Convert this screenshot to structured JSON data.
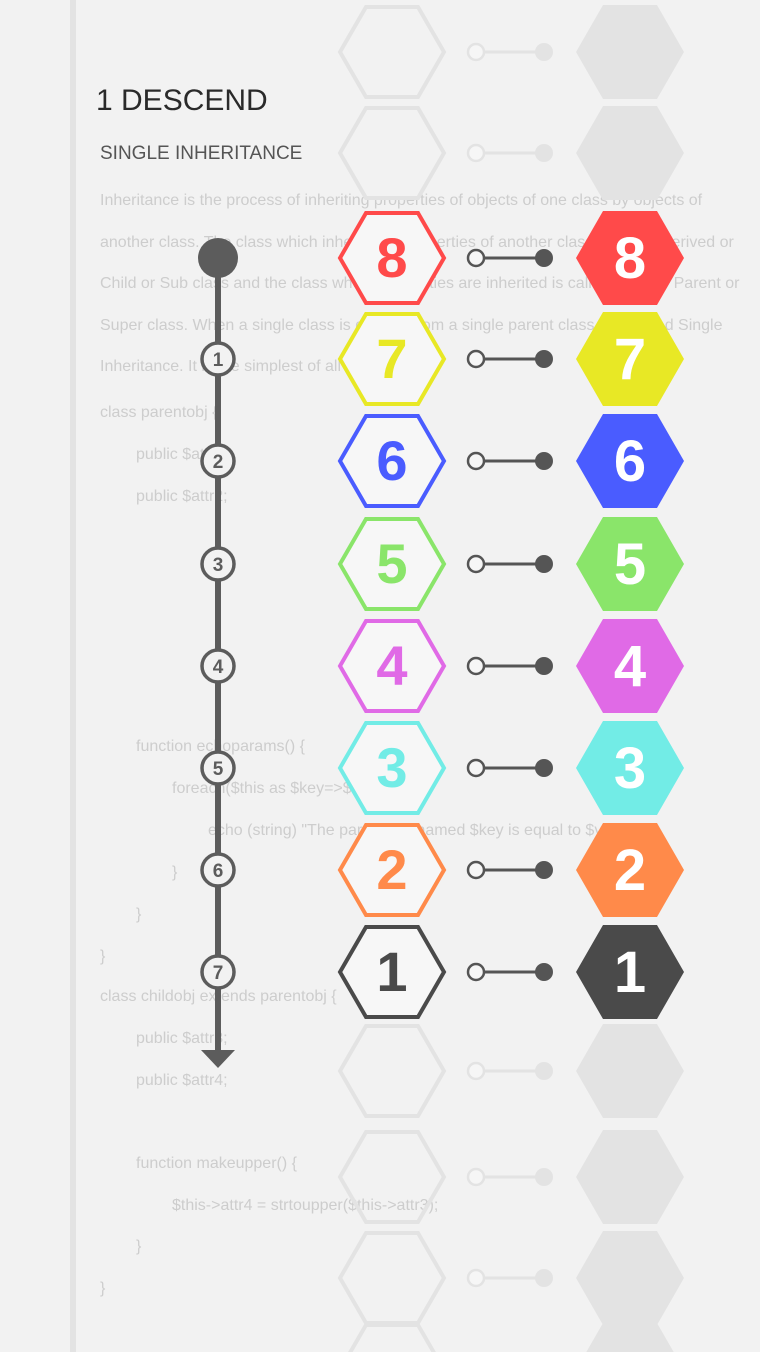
{
  "level": {
    "title": "1 DESCEND",
    "subtitle": "SINGLE INHERITANCE"
  },
  "background_text": {
    "paragraph": "Inheritance is the process of inheriting properties of objects of one class by objects of another class. The class which inherits the properties of another class is called Derived or Child or Sub class and the class whose properties are inherited is called Base or Parent or Super class. When a single class is derived from a single parent class, it is called Single Inheritance. It is the simplest of all inheritance.",
    "code_lines": [
      {
        "indent": 0,
        "text": "class parentobj {"
      },
      {
        "indent": 1,
        "text": "public $attr1;"
      },
      {
        "indent": 1,
        "text": "public $attr2;"
      },
      {
        "indent": 1,
        "text": "function echoparams() {"
      },
      {
        "indent": 2,
        "text": "foreach($this as $key=>$val) {"
      },
      {
        "indent": 3,
        "text": "echo (string) \"The parameter named $key is equal to $val<br>\";"
      },
      {
        "indent": 2,
        "text": "}"
      },
      {
        "indent": 1,
        "text": "}"
      },
      {
        "indent": 0,
        "text": "}"
      },
      {
        "indent": 0,
        "text": "class childobj extends parentobj {"
      },
      {
        "indent": 1,
        "text": "public $attr3;"
      },
      {
        "indent": 1,
        "text": "public $attr4;"
      },
      {
        "indent": 1,
        "text": "function makeupper() {"
      },
      {
        "indent": 2,
        "text": "$this->attr4 = strtoupper($this->attr3);"
      },
      {
        "indent": 1,
        "text": "}"
      },
      {
        "indent": 0,
        "text": "}"
      }
    ]
  },
  "timeline": {
    "steps": [
      "1",
      "2",
      "3",
      "4",
      "5",
      "6",
      "7"
    ],
    "color": "#5c5c5c"
  },
  "pairs": [
    {
      "value": "8",
      "color": "#ff4a4a"
    },
    {
      "value": "7",
      "color": "#e8e825"
    },
    {
      "value": "6",
      "color": "#4a5cff"
    },
    {
      "value": "5",
      "color": "#8ae56a"
    },
    {
      "value": "4",
      "color": "#e06ae6"
    },
    {
      "value": "3",
      "color": "#72ece6"
    },
    {
      "value": "2",
      "color": "#ff8a4a"
    },
    {
      "value": "1",
      "color": "#4a4a4a"
    }
  ],
  "colors": {
    "background": "#f2f2f2",
    "empty_hex": "#e3e3e3",
    "connector": "#555555"
  }
}
